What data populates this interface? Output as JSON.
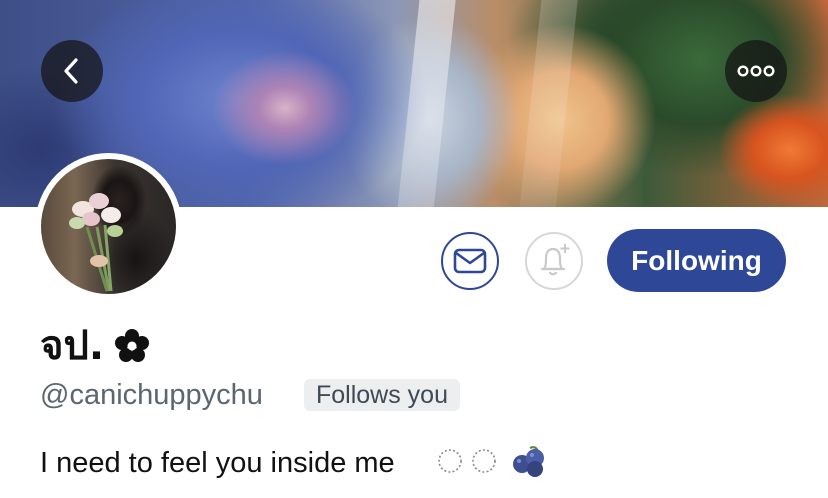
{
  "profile": {
    "display_name": "จป.",
    "handle": "@canichuppychu",
    "follows_you_badge": "Follows you",
    "bio": "I need to feel you inside me"
  },
  "actions": {
    "following_label": "Following"
  },
  "icons": {
    "back": "chevron-left-icon",
    "more": "ellipsis-icon",
    "message": "envelope-icon",
    "notify": "bell-plus-icon",
    "name_emoji": "black-flower-icon",
    "bio_emoji": [
      "dotted-circle-icon",
      "dotted-circle-icon",
      "blueberries-icon"
    ]
  },
  "colors": {
    "accent": "#2e4897",
    "muted_text": "#5b6670",
    "badge_bg": "#eceef0",
    "nav_button_bg": "#141414"
  }
}
